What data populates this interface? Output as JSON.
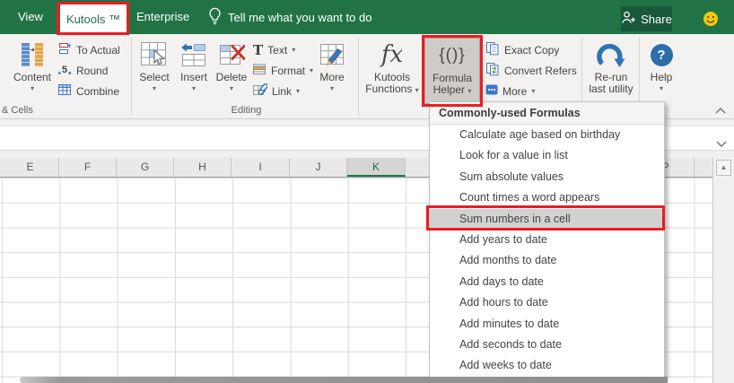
{
  "colors": {
    "excel_green": "#217346",
    "annotation_red": "#ec1c24",
    "ribbon_bg": "#f3f2f1",
    "pressed_button_bg": "#cfccc7",
    "menu_highlight": "#d1d1d1",
    "icon_blue": "#2e75b5",
    "icon_orange": "#e8a33d"
  },
  "titlebar": {
    "tabs": [
      {
        "label": "View"
      },
      {
        "label": "Kutools ™"
      },
      {
        "label": "Enterprise"
      }
    ],
    "active_tab": "Kutools ™",
    "tell_me": "Tell me what you want to do",
    "share_label": "Share"
  },
  "ribbon": {
    "content_label": "Content",
    "to_actual_label": "To Actual",
    "round_label": "Round",
    "combine_label": "Combine",
    "cells_group_label": "& Cells",
    "select_label": "Select",
    "insert_label": "Insert",
    "delete_label": "Delete",
    "text_label": "Text",
    "format_label": "Format",
    "link_label": "Link",
    "more_editing_label": "More",
    "editing_group_label": "Editing",
    "kutools_functions_label_1": "Kutools",
    "kutools_functions_label_2": "Functions",
    "formula_helper_label_1": "Formula",
    "formula_helper_label_2": "Helper",
    "exact_copy_label": "Exact Copy",
    "convert_refers_label": "Convert Refers",
    "more_label": "More",
    "rerun_label_1": "Re-run",
    "rerun_label_2": "last utility",
    "help_label": "Help"
  },
  "glyphs": {
    "dropdown_arrow": "▾",
    "text_T": "T",
    "fx": "fx",
    "formula_helper": "{()}",
    "question_mark": "?",
    "round_5": "5",
    "scroll_up": "▲"
  },
  "formula_bar": {
    "value": ""
  },
  "menu": {
    "header": "Commonly-used Formulas",
    "items": [
      {
        "label": "Calculate age based on birthday"
      },
      {
        "label": "Look for a value in list"
      },
      {
        "label": "Sum absolute values"
      },
      {
        "label": "Count times a word appears"
      },
      {
        "label": "Sum numbers in a cell"
      },
      {
        "label": "Add years to date"
      },
      {
        "label": "Add months to date"
      },
      {
        "label": "Add days to date"
      },
      {
        "label": "Add hours to date"
      },
      {
        "label": "Add minutes to date"
      },
      {
        "label": "Add seconds to date"
      },
      {
        "label": "Add weeks to date"
      }
    ],
    "highlighted_item": "Sum numbers in a cell"
  },
  "grid": {
    "columns": [
      "E",
      "F",
      "G",
      "H",
      "I",
      "J",
      "K"
    ],
    "selected_column": "K",
    "partial_column": "P"
  }
}
